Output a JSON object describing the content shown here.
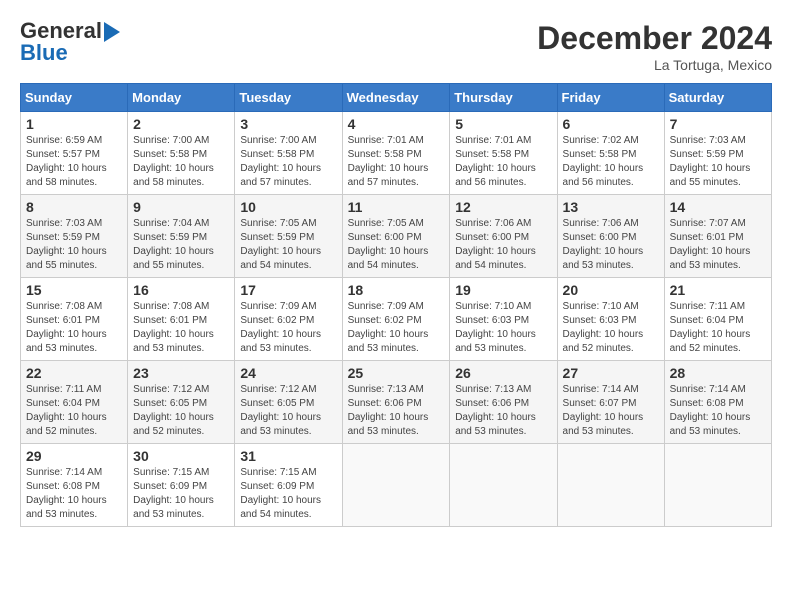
{
  "header": {
    "logo_line1": "General",
    "logo_line2": "Blue",
    "month_title": "December 2024",
    "location": "La Tortuga, Mexico"
  },
  "days_of_week": [
    "Sunday",
    "Monday",
    "Tuesday",
    "Wednesday",
    "Thursday",
    "Friday",
    "Saturday"
  ],
  "weeks": [
    [
      {
        "day": 1,
        "info": "Sunrise: 6:59 AM\nSunset: 5:57 PM\nDaylight: 10 hours\nand 58 minutes."
      },
      {
        "day": 2,
        "info": "Sunrise: 7:00 AM\nSunset: 5:58 PM\nDaylight: 10 hours\nand 58 minutes."
      },
      {
        "day": 3,
        "info": "Sunrise: 7:00 AM\nSunset: 5:58 PM\nDaylight: 10 hours\nand 57 minutes."
      },
      {
        "day": 4,
        "info": "Sunrise: 7:01 AM\nSunset: 5:58 PM\nDaylight: 10 hours\nand 57 minutes."
      },
      {
        "day": 5,
        "info": "Sunrise: 7:01 AM\nSunset: 5:58 PM\nDaylight: 10 hours\nand 56 minutes."
      },
      {
        "day": 6,
        "info": "Sunrise: 7:02 AM\nSunset: 5:58 PM\nDaylight: 10 hours\nand 56 minutes."
      },
      {
        "day": 7,
        "info": "Sunrise: 7:03 AM\nSunset: 5:59 PM\nDaylight: 10 hours\nand 55 minutes."
      }
    ],
    [
      {
        "day": 8,
        "info": "Sunrise: 7:03 AM\nSunset: 5:59 PM\nDaylight: 10 hours\nand 55 minutes."
      },
      {
        "day": 9,
        "info": "Sunrise: 7:04 AM\nSunset: 5:59 PM\nDaylight: 10 hours\nand 55 minutes."
      },
      {
        "day": 10,
        "info": "Sunrise: 7:05 AM\nSunset: 5:59 PM\nDaylight: 10 hours\nand 54 minutes."
      },
      {
        "day": 11,
        "info": "Sunrise: 7:05 AM\nSunset: 6:00 PM\nDaylight: 10 hours\nand 54 minutes."
      },
      {
        "day": 12,
        "info": "Sunrise: 7:06 AM\nSunset: 6:00 PM\nDaylight: 10 hours\nand 54 minutes."
      },
      {
        "day": 13,
        "info": "Sunrise: 7:06 AM\nSunset: 6:00 PM\nDaylight: 10 hours\nand 53 minutes."
      },
      {
        "day": 14,
        "info": "Sunrise: 7:07 AM\nSunset: 6:01 PM\nDaylight: 10 hours\nand 53 minutes."
      }
    ],
    [
      {
        "day": 15,
        "info": "Sunrise: 7:08 AM\nSunset: 6:01 PM\nDaylight: 10 hours\nand 53 minutes."
      },
      {
        "day": 16,
        "info": "Sunrise: 7:08 AM\nSunset: 6:01 PM\nDaylight: 10 hours\nand 53 minutes."
      },
      {
        "day": 17,
        "info": "Sunrise: 7:09 AM\nSunset: 6:02 PM\nDaylight: 10 hours\nand 53 minutes."
      },
      {
        "day": 18,
        "info": "Sunrise: 7:09 AM\nSunset: 6:02 PM\nDaylight: 10 hours\nand 53 minutes."
      },
      {
        "day": 19,
        "info": "Sunrise: 7:10 AM\nSunset: 6:03 PM\nDaylight: 10 hours\nand 53 minutes."
      },
      {
        "day": 20,
        "info": "Sunrise: 7:10 AM\nSunset: 6:03 PM\nDaylight: 10 hours\nand 52 minutes."
      },
      {
        "day": 21,
        "info": "Sunrise: 7:11 AM\nSunset: 6:04 PM\nDaylight: 10 hours\nand 52 minutes."
      }
    ],
    [
      {
        "day": 22,
        "info": "Sunrise: 7:11 AM\nSunset: 6:04 PM\nDaylight: 10 hours\nand 52 minutes."
      },
      {
        "day": 23,
        "info": "Sunrise: 7:12 AM\nSunset: 6:05 PM\nDaylight: 10 hours\nand 52 minutes."
      },
      {
        "day": 24,
        "info": "Sunrise: 7:12 AM\nSunset: 6:05 PM\nDaylight: 10 hours\nand 53 minutes."
      },
      {
        "day": 25,
        "info": "Sunrise: 7:13 AM\nSunset: 6:06 PM\nDaylight: 10 hours\nand 53 minutes."
      },
      {
        "day": 26,
        "info": "Sunrise: 7:13 AM\nSunset: 6:06 PM\nDaylight: 10 hours\nand 53 minutes."
      },
      {
        "day": 27,
        "info": "Sunrise: 7:14 AM\nSunset: 6:07 PM\nDaylight: 10 hours\nand 53 minutes."
      },
      {
        "day": 28,
        "info": "Sunrise: 7:14 AM\nSunset: 6:08 PM\nDaylight: 10 hours\nand 53 minutes."
      }
    ],
    [
      {
        "day": 29,
        "info": "Sunrise: 7:14 AM\nSunset: 6:08 PM\nDaylight: 10 hours\nand 53 minutes."
      },
      {
        "day": 30,
        "info": "Sunrise: 7:15 AM\nSunset: 6:09 PM\nDaylight: 10 hours\nand 53 minutes."
      },
      {
        "day": 31,
        "info": "Sunrise: 7:15 AM\nSunset: 6:09 PM\nDaylight: 10 hours\nand 54 minutes."
      },
      null,
      null,
      null,
      null
    ]
  ]
}
